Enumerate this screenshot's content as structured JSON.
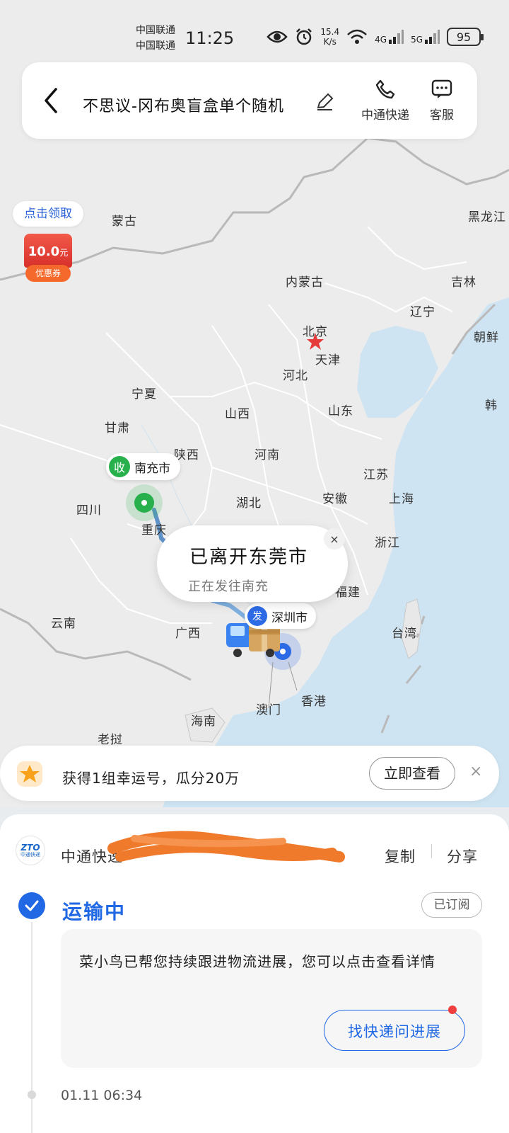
{
  "status_bar": {
    "carrier_1": "中国联通",
    "carrier_2": "中国联通",
    "time": "11:25",
    "net_speed_value": "15.4",
    "net_speed_unit": "K/s",
    "signal_1": "4G",
    "signal_2": "5G",
    "battery": "95"
  },
  "header": {
    "title": "不思议-冈布奥盲盒单个随机",
    "phone_label": "中通快递",
    "service_label": "客服"
  },
  "coupon": {
    "cta": "点击领取",
    "amount": "10.0",
    "unit": "元",
    "label": "优惠券"
  },
  "map": {
    "places": {
      "menggu": "蒙古",
      "heilongjiang": "黑龙江",
      "neimenggu": "内蒙古",
      "jilin": "吉林",
      "liaoning": "辽宁",
      "beijing": "北京",
      "tianjin": "天津",
      "chaoxian": "朝鲜",
      "hebei": "河北",
      "ningxia": "宁夏",
      "shanxi": "山西",
      "shandong": "山东",
      "hanguo": "韩",
      "gansu": "甘肃",
      "shaanxi": "陕西",
      "henan": "河南",
      "jiangsu": "江苏",
      "sichuan": "四川",
      "hubei": "湖北",
      "anhui": "安徽",
      "shanghai": "上海",
      "chongqing": "重庆",
      "zhejiang": "浙江",
      "fujian": "福建",
      "yunnan": "云南",
      "guangxi": "广西",
      "taiwan": "台湾",
      "aomen": "澳门",
      "xianggang": "香港",
      "hainan": "海南",
      "laowo": "老挝"
    },
    "receiver_badge": "收",
    "receiver_city": "南充市",
    "sender_badge": "发",
    "sender_city": "深圳市",
    "bubble_main": "已离开东莞市",
    "bubble_sub": "正在发往南充",
    "bubble_close": "×"
  },
  "lucky": {
    "text": "获得1组幸运号，瓜分20万",
    "button": "立即查看",
    "close": "×"
  },
  "sheet": {
    "logo_text": "ZTO",
    "logo_sub": "中通快递",
    "courier": "中通快递",
    "copy": "复制",
    "share": "分享",
    "state": "运输中",
    "subscribed": "已订阅",
    "notice": "菜小鸟已帮您持续跟进物流进展，您可以点击查看详情",
    "ask_button": "找快递问进展",
    "timestamp": "01.11 06:34"
  },
  "colors": {
    "accent_blue": "#2168e4",
    "receiver_green": "#27b04c",
    "scribble_orange": "#f07a2c",
    "sea": "#cfe4f2",
    "land": "#ececec"
  }
}
